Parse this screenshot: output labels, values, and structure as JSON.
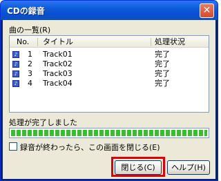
{
  "window": {
    "title": "CDの録音",
    "close_glyph": "✕"
  },
  "tracks_group": {
    "label": "曲の一覧(R)",
    "columns": {
      "no": "No.",
      "title": "タイトル",
      "status": "処理状況"
    },
    "rows": [
      {
        "no": "1",
        "title": "Track01",
        "status": "完了",
        "icon": "music-icon"
      },
      {
        "no": "2",
        "title": "Track02",
        "status": "完了",
        "icon": "music-icon"
      },
      {
        "no": "3",
        "title": "Track03",
        "status": "完了",
        "icon": "music-icon"
      },
      {
        "no": "4",
        "title": "Track04",
        "status": "完了",
        "icon": "music-icon"
      }
    ]
  },
  "progress": {
    "label": "処理が完了しました",
    "fraction": 1.0,
    "fill_color": "#35c12a"
  },
  "close_on_finish": {
    "label": "録音が終わったら、この画面を閉じる(E)",
    "checked": false
  },
  "buttons": {
    "close_label": "閉じる(C)",
    "help_label": "ヘルプ(H)"
  },
  "highlight_color": "#e00000"
}
